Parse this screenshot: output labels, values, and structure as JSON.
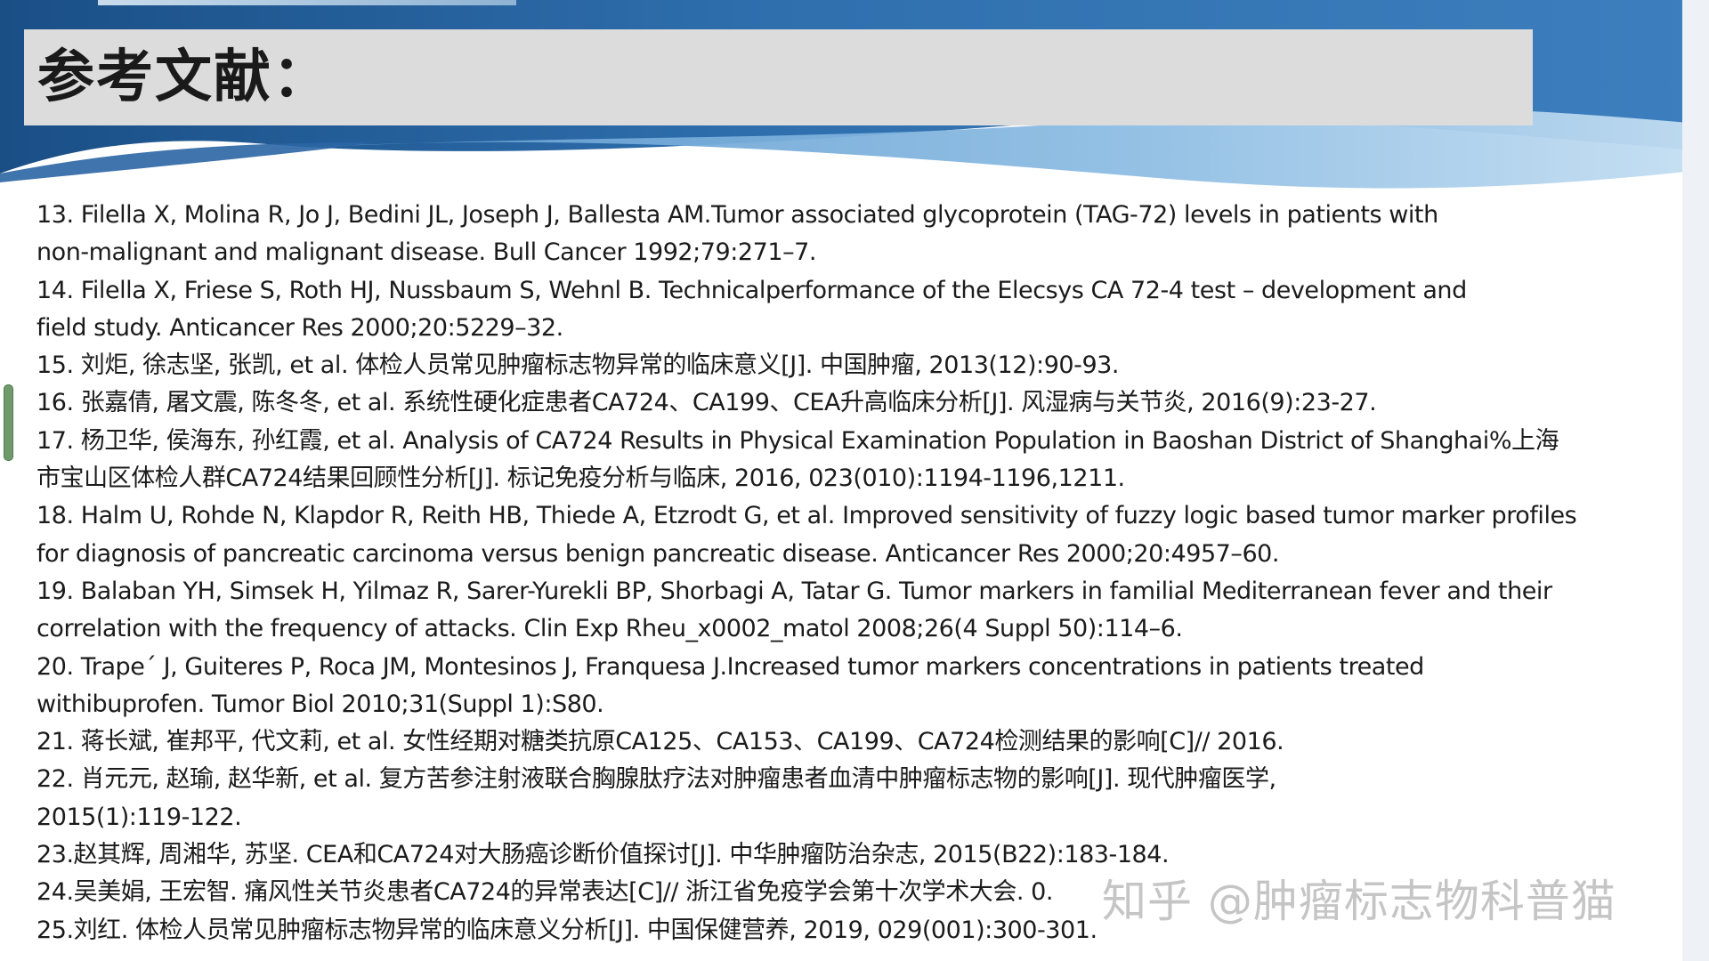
{
  "title": "参考文献：",
  "references": [
    {
      "lines": [
        "13. Filella X, Molina R, Jo J, Bedini JL, Joseph J, Ballesta AM.Tumor associated glycoprotein (TAG-72) levels in patients with",
        "non-malignant and malignant disease. Bull Cancer 1992;79:271–7."
      ]
    },
    {
      "lines": [
        "14. Filella X, Friese S, Roth HJ, Nussbaum S, Wehnl B. Technicalperformance of the Elecsys CA 72-4 test – development and",
        "field study. Anticancer Res 2000;20:5229–32."
      ]
    },
    {
      "lines": [
        "15. 刘炬, 徐志坚, 张凯, et al. 体检人员常见肿瘤标志物异常的临床意义[J]. 中国肿瘤, 2013(12):90-93."
      ]
    },
    {
      "lines": [
        "16. 张嘉倩, 屠文震, 陈冬冬, et al. 系统性硬化症患者CA724、CA199、CEA升高临床分析[J]. 风湿病与关节炎, 2016(9):23-27."
      ]
    },
    {
      "lines": [
        "17. 杨卫华, 侯海东, 孙红霞, et al. Analysis of CA724 Results in Physical Examination Population in Baoshan District of Shanghai%上海",
        "市宝山区体检人群CA724结果回顾性分析[J]. 标记免疫分析与临床, 2016, 023(010):1194-1196,1211."
      ]
    },
    {
      "lines": [
        "18. Halm U, Rohde N, Klapdor R, Reith HB, Thiede A, Etzrodt G, et al. Improved sensitivity of fuzzy logic based tumor marker profiles",
        "for diagnosis of pancreatic carcinoma versus benign pancreatic disease. Anticancer Res 2000;20:4957–60."
      ]
    },
    {
      "lines": [
        "19. Balaban YH, Simsek H, Yilmaz R, Sarer-Yurekli BP, Shorbagi A, Tatar G. Tumor markers in familial Mediterranean fever and their",
        "correlation with the frequency of attacks. Clin Exp Rheu_x0002_matol 2008;26(4 Suppl 50):114–6."
      ]
    },
    {
      "lines": [
        "20. Trape´ J, Guiteres P, Roca JM, Montesinos J, Franquesa J.Increased tumor markers concentrations in patients treated",
        "withibuprofen. Tumor Biol 2010;31(Suppl 1):S80."
      ]
    },
    {
      "lines": [
        "21. 蒋长斌, 崔邦平, 代文莉, et al. 女性经期对糖类抗原CA125、CA153、CA199、CA724检测结果的影响[C]// 2016."
      ]
    },
    {
      "lines": [
        "22. 肖元元, 赵瑜, 赵华新, et al. 复方苦参注射液联合胸腺肽疗法对肿瘤患者血清中肿瘤标志物的影响[J]. 现代肿瘤医学,",
        "2015(1):119-122."
      ]
    },
    {
      "lines": [
        "23.赵其辉, 周湘华, 苏坚. CEA和CA724对大肠癌诊断价值探讨[J]. 中华肿瘤防治杂志, 2015(B22):183-184."
      ]
    },
    {
      "lines": [
        "24.吴美娟, 王宏智. 痛风性关节炎患者CA724的异常表达[C]// 浙江省免疫学会第十次学术大会. 0."
      ]
    },
    {
      "lines": [
        "25.刘红. 体检人员常见肿瘤标志物异常的临床意义分析[J]. 中国保健营养, 2019, 029(001):300-301."
      ]
    }
  ],
  "watermark": "知乎 @肿瘤标志物科普猫",
  "colors": {
    "header_dark": "#1f5b95",
    "header_mid": "#4a89c4",
    "header_light": "#9cc4e6",
    "title_box": "#dcdcdc",
    "text": "#1b1b1b",
    "scroll_handle": "#6f9a6b"
  }
}
